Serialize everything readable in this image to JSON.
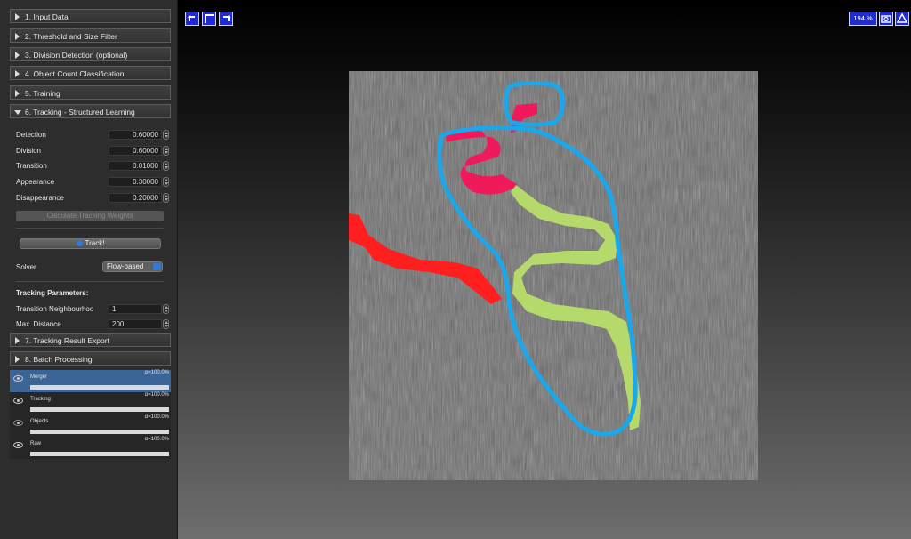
{
  "applets": [
    {
      "label": "1. Input Data"
    },
    {
      "label": "2. Threshold and Size Filter"
    },
    {
      "label": "3. Division Detection (optional)"
    },
    {
      "label": "4. Object Count Classification"
    },
    {
      "label": "5. Training"
    },
    {
      "label": "6. Tracking - Structured Learning"
    },
    {
      "label": "7. Tracking Result Export"
    },
    {
      "label": "8. Batch Processing"
    }
  ],
  "weights": [
    {
      "label": "Detection",
      "value": "0.60000"
    },
    {
      "label": "Division",
      "value": "0.60000"
    },
    {
      "label": "Transition",
      "value": "0.01000"
    },
    {
      "label": "Appearance",
      "value": "0.30000"
    },
    {
      "label": "Disappearance",
      "value": "0.20000"
    }
  ],
  "calc_button": "Calculate Tracking Weights",
  "track_button": "Track!",
  "solver": {
    "label": "Solver",
    "value": "Flow-based"
  },
  "params": {
    "heading": "Tracking Parameters:",
    "neighbourhood": {
      "label": "Transition Neighbourhoo",
      "value": "1"
    },
    "max_distance": {
      "label": "Max. Distance",
      "value": "200"
    }
  },
  "layers": [
    {
      "name": "Merger",
      "opacity": "α=100.0%",
      "selected": true
    },
    {
      "name": "Tracking",
      "opacity": "α=100.0%"
    },
    {
      "name": "Objects",
      "opacity": "α=100.0%"
    },
    {
      "name": "Raw",
      "opacity": "α=100.0%"
    }
  ],
  "viewer": {
    "zoom": "194 %"
  },
  "colors": {
    "track_green": "#b5d96a",
    "track_red": "#ff1f1f",
    "merger_pink": "#f0195a",
    "annotation_blue": "#1aa7ec",
    "toolbar_blue": "#1f2bd6"
  }
}
